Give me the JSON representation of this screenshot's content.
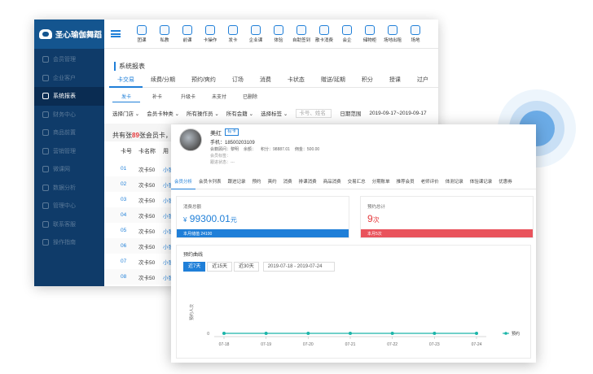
{
  "app": {
    "brand": "圣心瑜伽舞蹈"
  },
  "sidebar": {
    "items": [
      {
        "label": "会员管理",
        "active": false
      },
      {
        "label": "企业客户",
        "active": false
      },
      {
        "label": "系统报表",
        "active": true
      },
      {
        "label": "财务中心",
        "active": false
      },
      {
        "label": "商品前置",
        "active": false
      },
      {
        "label": "营销管理",
        "active": false
      },
      {
        "label": "微课网",
        "active": false
      },
      {
        "label": "数据分析",
        "active": false
      },
      {
        "label": "管理中心",
        "active": false
      },
      {
        "label": "联系客服",
        "active": false
      },
      {
        "label": "操作指南",
        "active": false
      }
    ]
  },
  "toolbar": {
    "items": [
      "团课",
      "私教",
      "前课",
      "卡操作",
      "发卡",
      "企业课",
      "体验",
      "自助签到",
      "散卡消费",
      "会企",
      "储物柜",
      "场地出租",
      "场地"
    ]
  },
  "report": {
    "title": "系统报表",
    "tabs": [
      "卡交易",
      "续费/分期",
      "预约/爽约",
      "订场",
      "消费",
      "卡状态",
      "赠送/延期",
      "积分",
      "授课",
      "过户"
    ],
    "subtabs": [
      "发卡",
      "补卡",
      "升级卡",
      "未支付",
      "已删除"
    ],
    "filters": [
      "选择门店",
      "会员卡种类",
      "所有操作员",
      "所有会籍",
      "选择标签"
    ],
    "search_placeholder": "卡号、姓名",
    "date_label": "日期范围",
    "date_value": "2019-09-17~2019-09-17",
    "summary_prefix": "共有张",
    "summary_count": "89",
    "summary_suffix": "张会员卡，发",
    "columns": [
      "卡号",
      "卡名称",
      "用"
    ],
    "rows": [
      {
        "no": "01",
        "name": "次卡50",
        "u": "小张"
      },
      {
        "no": "02",
        "name": "次卡50",
        "u": "小张"
      },
      {
        "no": "03",
        "name": "次卡50",
        "u": "小张"
      },
      {
        "no": "04",
        "name": "次卡50",
        "u": "小张"
      },
      {
        "no": "05",
        "name": "次卡50",
        "u": "小张"
      },
      {
        "no": "06",
        "name": "次卡50",
        "u": "小张"
      },
      {
        "no": "07",
        "name": "次卡50",
        "u": "小张"
      },
      {
        "no": "08",
        "name": "次卡50",
        "u": "小张"
      }
    ]
  },
  "member": {
    "name": "美红",
    "tag": "有卡",
    "phone": "手机：18500203109",
    "info": [
      "会籍顾问：黎明",
      "余额：",
      "积分：98887.01",
      "佣金：500.00"
    ],
    "line2": "会员标签：",
    "line3": "跟进状态：---",
    "tabs": [
      "会员分析",
      "会员卡列表",
      "跟进记录",
      "预约",
      "爽约",
      "消费",
      "排课消费",
      "商品消费",
      "交易汇总",
      "分期账单",
      "推荐会员",
      "老师评价",
      "体测记录",
      "体验课记录",
      "优惠券"
    ],
    "total_label": "消费总额",
    "total_currency": "¥",
    "total_value": "99300.01",
    "total_unit": "元",
    "total_bar": "本月储值 24100",
    "booking_label": "预约总计",
    "booking_value": "9",
    "booking_unit": "次",
    "booking_bar": "本月5次"
  },
  "trend": {
    "title": "预约曲线",
    "ranges": [
      "近7天",
      "近15天",
      "近30天"
    ],
    "date_range": "2019-07-18 - 2019-07-24"
  },
  "chart_data": {
    "type": "line",
    "categories": [
      "07-18",
      "07-19",
      "07-20",
      "07-21",
      "07-22",
      "07-23",
      "07-24"
    ],
    "series": [
      {
        "name": "预约",
        "values": [
          0,
          0,
          0,
          0,
          0,
          0,
          0
        ]
      }
    ],
    "ylabel": "预约人次",
    "ylim": [
      0,
      1
    ],
    "legend": "right",
    "color": "#1cb5a9"
  },
  "colors": {
    "primary": "#1f7fd8",
    "sidebar": "#0f3b69",
    "danger": "#e4393c",
    "accent_green": "#1cb5a9"
  }
}
